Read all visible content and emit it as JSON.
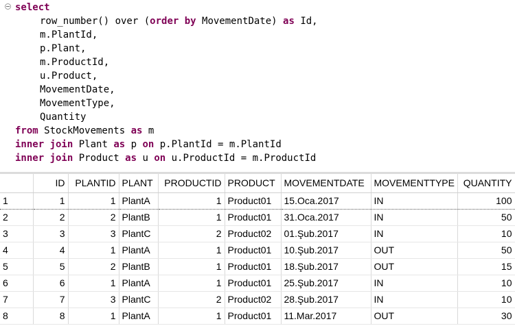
{
  "editor": {
    "lines": [
      {
        "parts": [
          {
            "t": "select",
            "k": true
          }
        ],
        "indent": false
      },
      {
        "parts": [
          {
            "t": "row_number() over (",
            "k": false
          },
          {
            "t": "order by",
            "k": true
          },
          {
            "t": " MovementDate) ",
            "k": false
          },
          {
            "t": "as",
            "k": true
          },
          {
            "t": " Id,",
            "k": false
          }
        ],
        "indent": true
      },
      {
        "parts": [
          {
            "t": "m.PlantId,",
            "k": false
          }
        ],
        "indent": true
      },
      {
        "parts": [
          {
            "t": "p.Plant,",
            "k": false
          }
        ],
        "indent": true
      },
      {
        "parts": [
          {
            "t": "m.ProductId,",
            "k": false
          }
        ],
        "indent": true
      },
      {
        "parts": [
          {
            "t": "u.Product,",
            "k": false
          }
        ],
        "indent": true
      },
      {
        "parts": [
          {
            "t": "MovementDate,",
            "k": false
          }
        ],
        "indent": true
      },
      {
        "parts": [
          {
            "t": "MovementType,",
            "k": false
          }
        ],
        "indent": true
      },
      {
        "parts": [
          {
            "t": "Quantity",
            "k": false
          }
        ],
        "indent": true
      },
      {
        "parts": [
          {
            "t": "from",
            "k": true
          },
          {
            "t": " StockMovements ",
            "k": false
          },
          {
            "t": "as",
            "k": true
          },
          {
            "t": " m",
            "k": false
          }
        ],
        "indent": false
      },
      {
        "parts": [
          {
            "t": "inner join",
            "k": true
          },
          {
            "t": " Plant ",
            "k": false
          },
          {
            "t": "as",
            "k": true
          },
          {
            "t": " p ",
            "k": false
          },
          {
            "t": "on",
            "k": true
          },
          {
            "t": " p.PlantId = m.PlantId",
            "k": false
          }
        ],
        "indent": false
      },
      {
        "parts": [
          {
            "t": "inner join",
            "k": true
          },
          {
            "t": " Product ",
            "k": false
          },
          {
            "t": "as",
            "k": true
          },
          {
            "t": " u ",
            "k": false
          },
          {
            "t": "on",
            "k": true
          },
          {
            "t": " u.ProductId = m.ProductId",
            "k": false
          }
        ],
        "indent": false
      }
    ]
  },
  "grid": {
    "columns": [
      "",
      "ID",
      "PLANTID",
      "PLANT",
      "PRODUCTID",
      "PRODUCT",
      "MOVEMENTDATE",
      "MOVEMENTTYPE",
      "QUANTITY"
    ],
    "rows": [
      [
        "1",
        "1",
        "1",
        "PlantA",
        "1",
        "Product01",
        "15.Oca.2017",
        "IN",
        "100"
      ],
      [
        "2",
        "2",
        "2",
        "PlantB",
        "1",
        "Product01",
        "31.Oca.2017",
        "IN",
        "50"
      ],
      [
        "3",
        "3",
        "3",
        "PlantC",
        "2",
        "Product02",
        "01.Şub.2017",
        "IN",
        "10"
      ],
      [
        "4",
        "4",
        "1",
        "PlantA",
        "1",
        "Product01",
        "10.Şub.2017",
        "OUT",
        "50"
      ],
      [
        "5",
        "5",
        "2",
        "PlantB",
        "1",
        "Product01",
        "18.Şub.2017",
        "OUT",
        "15"
      ],
      [
        "6",
        "6",
        "1",
        "PlantA",
        "1",
        "Product01",
        "25.Şub.2017",
        "IN",
        "10"
      ],
      [
        "7",
        "7",
        "3",
        "PlantC",
        "2",
        "Product02",
        "28.Şub.2017",
        "IN",
        "10"
      ],
      [
        "8",
        "8",
        "1",
        "PlantA",
        "1",
        "Product01",
        "11.Mar.2017",
        "OUT",
        "30"
      ]
    ],
    "selected_row": 0
  },
  "colors": {
    "keyword": "#7f0055",
    "grid_line": "#d9d9d9"
  }
}
